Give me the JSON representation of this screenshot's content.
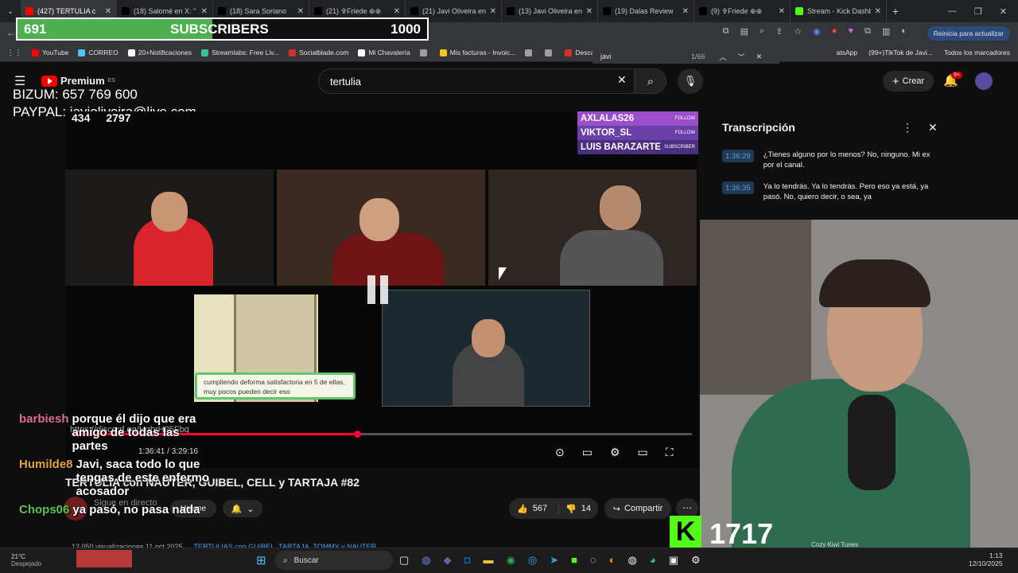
{
  "tabs": [
    {
      "title": "(427) TERTULIA c",
      "fav": "#ff0000",
      "active": true
    },
    {
      "title": "(18) Salomé en X: \"",
      "fav": "#000000"
    },
    {
      "title": "(18) Sara Soriano",
      "fav": "#000000"
    },
    {
      "title": "(21) ✞Friede ⊕⊕",
      "fav": "#000000"
    },
    {
      "title": "(21) Javi Oliveira en X",
      "fav": "#000000"
    },
    {
      "title": "(13) Javi Oliveira en X",
      "fav": "#000000"
    },
    {
      "title": "(19) Dalas Review",
      "fav": "#000000"
    },
    {
      "title": "(9) ✞Friede ⊕⊕",
      "fav": "#000000"
    },
    {
      "title": "Stream - Kick Dashb",
      "fav": "#53fc18"
    }
  ],
  "browser": {
    "new_tab": "+",
    "update_label": "Reinicia para actualizar",
    "find_query": "javi",
    "find_count": "1/66",
    "bookmarks": [
      {
        "label": "YouTube",
        "color": "#ff0000"
      },
      {
        "label": "CORREO",
        "color": "#4fc3f7"
      },
      {
        "label": "20+Notificaciones",
        "color": "#ffffff"
      },
      {
        "label": "Streamlabs: Free Liv...",
        "color": "#31c3a2"
      },
      {
        "label": "Socialblade.com",
        "color": "#d32f2f"
      },
      {
        "label": "Mi Chavalería",
        "color": "#ffffff"
      },
      {
        "label": "",
        "color": "#9e9e9e"
      },
      {
        "label": "Mis facturas - Invoic...",
        "color": "#f5c518"
      },
      {
        "label": "",
        "color": "#9e9e9e"
      },
      {
        "label": "",
        "color": "#9e9e9e"
      },
      {
        "label": "Descargado",
        "color": "#d32f2f"
      }
    ],
    "bookmarks_right": [
      "atsApp",
      "(99+)TikTok de Javi...",
      "Todos los marcadores"
    ]
  },
  "overlay": {
    "subs_current": "691",
    "subs_label": "SUBSCRIBERS",
    "subs_goal": "1000",
    "subs_progress": 0.691,
    "bizum": "BIZUM: 657 769 600",
    "paypal": "PAYPAL: javioliveira@live.com",
    "viewer_count_a": "434",
    "viewer_count_b": "2797",
    "kick_count": "1717",
    "music_label": "Cozy Kiwi Tunes"
  },
  "youtube": {
    "logo": "Premium",
    "region": "ES",
    "search_value": "tertulia",
    "create_label": "Crear",
    "notif_badge": "9+"
  },
  "video": {
    "time_current": "1:36:41",
    "time_total": "3:29:16",
    "progress": 0.46,
    "discord_link": "https://discord.gg/HqbrH25Fbq",
    "caption_box": "cumpliendo deforma satisfactoria en 5 de ellas, muy pocos pueden decir eso",
    "stream_chat": [
      {
        "user": "AXLALAS26",
        "tag": "FOLLOW",
        "color": "#9b4dca"
      },
      {
        "user": "VIKTOR_SL",
        "tag": "FOLLOW",
        "color": "#6a3fa8"
      },
      {
        "user": "LUIS BARAZARTE",
        "tag": "SUBSCRIBER",
        "color": "#4a2f80"
      }
    ]
  },
  "below_video": {
    "title": "TERTULIA con NAUTER, GUIBEL, CELL y TARTAJA #82",
    "live_label": "Sigue en directo",
    "unsub_label": "Unirme",
    "likes": "567",
    "dislikes": "14",
    "share_label": "Compartir",
    "meta": "12.050 visualizaciones  11 oct 2025",
    "hashtags": "TERTULIAS con GUIBEL, TARTAJA, TOMMY y NAUTER"
  },
  "transcript": {
    "title": "Transcripción",
    "entries": [
      {
        "time": "1:36:29",
        "text": "¿Tienes alguno por lo menos? No, ninguno. Mi ex por el canal."
      },
      {
        "time": "1:36:35",
        "text": "Ya lo tendrás. Ya lo tendrás. Pero eso ya está, ya pasó. No, quiero decir, o sea, ya"
      }
    ]
  },
  "chat_overlay": [
    {
      "user": "barbiesh",
      "color": "#e06c9f",
      "msg": "porque él dijo que era amigo de todas las partes"
    },
    {
      "user": "Humilde8",
      "color": "#e8a33d",
      "msg": "Javi, saca todo lo que tengas de este enfermo acosador"
    },
    {
      "user": "Chops06",
      "color": "#56c456",
      "msg": "ya pasó, no pasa nada"
    }
  ],
  "taskbar": {
    "weather_temp": "21°C",
    "weather_desc": "Despejado",
    "search_label": "Buscar",
    "time": "1:13",
    "date": "12/10/2025"
  }
}
